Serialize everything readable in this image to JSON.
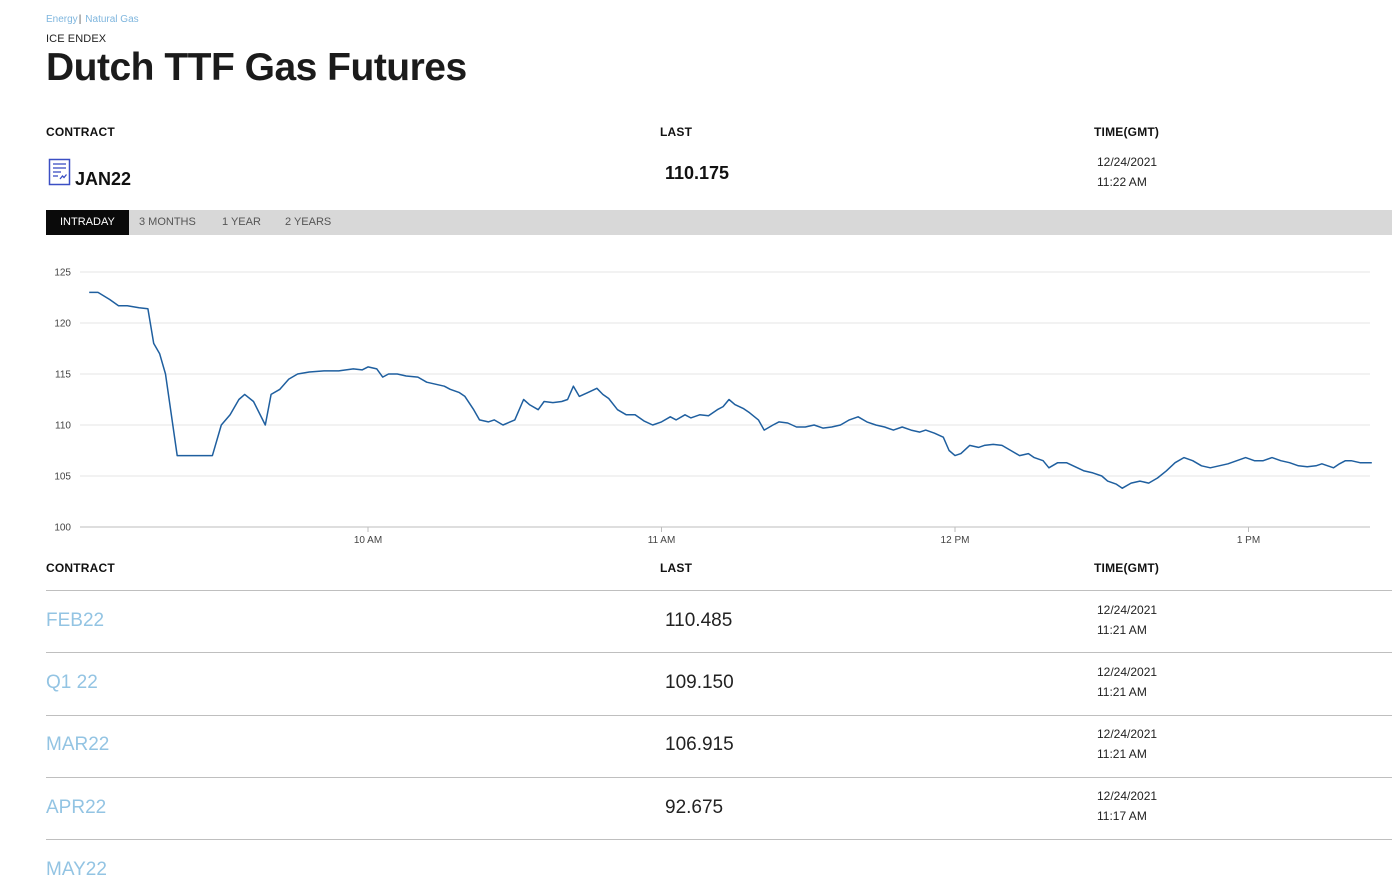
{
  "breadcrumb": {
    "item1": "Energy",
    "item2": "Natural Gas"
  },
  "exchange": "ICE ENDEX",
  "title": "Dutch TTF Gas Futures",
  "headers": {
    "contract": "CONTRACT",
    "last": "LAST",
    "time": "TIME(GMT)"
  },
  "main": {
    "contract": "JAN22",
    "last": "110.175",
    "date": "12/24/2021",
    "time": "11:22 AM"
  },
  "tabs": [
    "INTRADAY",
    "3 MONTHS",
    "1 YEAR",
    "2 YEARS"
  ],
  "active_tab": "INTRADAY",
  "colors": {
    "line": "#1f5f9f",
    "link": "#93c4e3",
    "grid": "#e6e6e6"
  },
  "chart_data": {
    "type": "line",
    "ylim": [
      100,
      125
    ],
    "yticks": [
      "100",
      "105",
      "110",
      "115",
      "120",
      "125"
    ],
    "xtick_labels": [
      "10 AM",
      "11 AM",
      "12 PM",
      "1 PM"
    ],
    "x_range_minutes": [
      9.05,
      13.42
    ],
    "xtick_minutes": [
      10,
      11,
      12,
      13
    ],
    "series": [
      {
        "points": [
          [
            9.05,
            123.0
          ],
          [
            9.08,
            123.0
          ],
          [
            9.12,
            122.3
          ],
          [
            9.15,
            121.7
          ],
          [
            9.18,
            121.7
          ],
          [
            9.22,
            121.5
          ],
          [
            9.25,
            121.4
          ],
          [
            9.27,
            118.0
          ],
          [
            9.29,
            117.0
          ],
          [
            9.31,
            115.0
          ],
          [
            9.35,
            107.0
          ],
          [
            9.42,
            107.0
          ],
          [
            9.47,
            107.0
          ],
          [
            9.5,
            110.0
          ],
          [
            9.53,
            111.0
          ],
          [
            9.56,
            112.5
          ],
          [
            9.58,
            113.0
          ],
          [
            9.61,
            112.3
          ],
          [
            9.65,
            110.0
          ],
          [
            9.67,
            113.0
          ],
          [
            9.7,
            113.5
          ],
          [
            9.73,
            114.5
          ],
          [
            9.76,
            115.0
          ],
          [
            9.8,
            115.2
          ],
          [
            9.85,
            115.3
          ],
          [
            9.9,
            115.3
          ],
          [
            9.95,
            115.5
          ],
          [
            9.98,
            115.4
          ],
          [
            10.0,
            115.7
          ],
          [
            10.03,
            115.5
          ],
          [
            10.05,
            114.7
          ],
          [
            10.07,
            115.0
          ],
          [
            10.1,
            115.0
          ],
          [
            10.13,
            114.8
          ],
          [
            10.17,
            114.7
          ],
          [
            10.2,
            114.2
          ],
          [
            10.23,
            114.0
          ],
          [
            10.26,
            113.8
          ],
          [
            10.28,
            113.5
          ],
          [
            10.31,
            113.2
          ],
          [
            10.33,
            112.8
          ],
          [
            10.36,
            111.5
          ],
          [
            10.38,
            110.5
          ],
          [
            10.41,
            110.3
          ],
          [
            10.43,
            110.5
          ],
          [
            10.46,
            110.0
          ],
          [
            10.5,
            110.5
          ],
          [
            10.53,
            112.5
          ],
          [
            10.55,
            112.0
          ],
          [
            10.58,
            111.5
          ],
          [
            10.6,
            112.3
          ],
          [
            10.63,
            112.2
          ],
          [
            10.66,
            112.3
          ],
          [
            10.68,
            112.5
          ],
          [
            10.7,
            113.8
          ],
          [
            10.72,
            112.8
          ],
          [
            10.75,
            113.2
          ],
          [
            10.78,
            113.6
          ],
          [
            10.8,
            113.0
          ],
          [
            10.82,
            112.6
          ],
          [
            10.85,
            111.5
          ],
          [
            10.88,
            111.0
          ],
          [
            10.91,
            111.0
          ],
          [
            10.94,
            110.4
          ],
          [
            10.97,
            110.0
          ],
          [
            11.0,
            110.3
          ],
          [
            11.03,
            110.8
          ],
          [
            11.05,
            110.5
          ],
          [
            11.08,
            111.0
          ],
          [
            11.1,
            110.7
          ],
          [
            11.13,
            111.0
          ],
          [
            11.16,
            110.9
          ],
          [
            11.19,
            111.5
          ],
          [
            11.21,
            111.8
          ],
          [
            11.23,
            112.5
          ],
          [
            11.25,
            112.0
          ],
          [
            11.28,
            111.6
          ],
          [
            11.3,
            111.2
          ],
          [
            11.33,
            110.5
          ],
          [
            11.35,
            109.5
          ],
          [
            11.38,
            110.0
          ],
          [
            11.4,
            110.3
          ],
          [
            11.43,
            110.2
          ],
          [
            11.46,
            109.8
          ],
          [
            11.49,
            109.8
          ],
          [
            11.52,
            110.0
          ],
          [
            11.55,
            109.7
          ],
          [
            11.58,
            109.8
          ],
          [
            11.61,
            110.0
          ],
          [
            11.64,
            110.5
          ],
          [
            11.67,
            110.8
          ],
          [
            11.7,
            110.3
          ],
          [
            11.73,
            110.0
          ],
          [
            11.76,
            109.8
          ],
          [
            11.79,
            109.5
          ],
          [
            11.82,
            109.8
          ],
          [
            11.85,
            109.5
          ],
          [
            11.88,
            109.3
          ],
          [
            11.9,
            109.5
          ],
          [
            11.93,
            109.2
          ],
          [
            11.96,
            108.8
          ],
          [
            11.98,
            107.5
          ],
          [
            12.0,
            107.0
          ],
          [
            12.02,
            107.2
          ],
          [
            12.05,
            108.0
          ],
          [
            12.08,
            107.8
          ],
          [
            12.1,
            108.0
          ],
          [
            12.13,
            108.1
          ],
          [
            12.16,
            108.0
          ],
          [
            12.19,
            107.5
          ],
          [
            12.22,
            107.0
          ],
          [
            12.25,
            107.2
          ],
          [
            12.27,
            106.8
          ],
          [
            12.3,
            106.5
          ],
          [
            12.32,
            105.8
          ],
          [
            12.35,
            106.3
          ],
          [
            12.38,
            106.3
          ],
          [
            12.41,
            105.9
          ],
          [
            12.44,
            105.5
          ],
          [
            12.47,
            105.3
          ],
          [
            12.5,
            105.0
          ],
          [
            12.52,
            104.5
          ],
          [
            12.55,
            104.2
          ],
          [
            12.57,
            103.8
          ],
          [
            12.6,
            104.3
          ],
          [
            12.63,
            104.5
          ],
          [
            12.66,
            104.3
          ],
          [
            12.69,
            104.8
          ],
          [
            12.72,
            105.5
          ],
          [
            12.75,
            106.3
          ],
          [
            12.78,
            106.8
          ],
          [
            12.81,
            106.5
          ],
          [
            12.84,
            106.0
          ],
          [
            12.87,
            105.8
          ],
          [
            12.9,
            106.0
          ],
          [
            12.93,
            106.2
          ],
          [
            12.96,
            106.5
          ],
          [
            12.99,
            106.8
          ],
          [
            13.02,
            106.5
          ],
          [
            13.05,
            106.5
          ],
          [
            13.08,
            106.8
          ],
          [
            13.11,
            106.5
          ],
          [
            13.14,
            106.3
          ],
          [
            13.17,
            106.0
          ],
          [
            13.2,
            105.9
          ],
          [
            13.23,
            106.0
          ],
          [
            13.25,
            106.2
          ],
          [
            13.27,
            106.0
          ],
          [
            13.29,
            105.8
          ],
          [
            13.31,
            106.2
          ],
          [
            13.33,
            106.5
          ],
          [
            13.35,
            106.5
          ],
          [
            13.38,
            106.3
          ],
          [
            13.42,
            106.3
          ]
        ]
      }
    ]
  },
  "rows": [
    {
      "contract": "FEB22",
      "last": "110.485",
      "date": "12/24/2021",
      "time": "11:21 AM"
    },
    {
      "contract": "Q1 22",
      "last": "109.150",
      "date": "12/24/2021",
      "time": "11:21 AM"
    },
    {
      "contract": "MAR22",
      "last": "106.915",
      "date": "12/24/2021",
      "time": "11:21 AM"
    },
    {
      "contract": "APR22",
      "last": "92.675",
      "date": "12/24/2021",
      "time": "11:17 AM"
    },
    {
      "contract": "MAY22",
      "last": "",
      "date": "",
      "time": ""
    }
  ]
}
